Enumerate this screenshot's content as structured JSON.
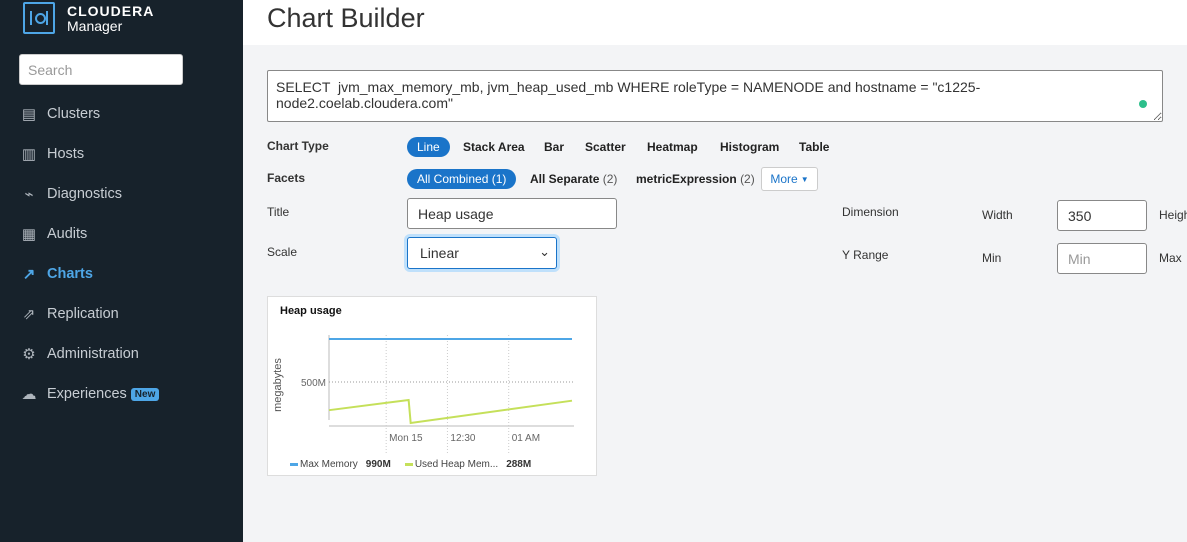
{
  "brand": {
    "name": "CLOUDERA",
    "product": "Manager"
  },
  "sidebar": {
    "search_placeholder": "Search",
    "items": [
      {
        "label": "Clusters",
        "icon": "server-icon"
      },
      {
        "label": "Hosts",
        "icon": "hosts-icon"
      },
      {
        "label": "Diagnostics",
        "icon": "diagnostics-icon"
      },
      {
        "label": "Audits",
        "icon": "audit-icon"
      },
      {
        "label": "Charts",
        "icon": "chart-icon",
        "active": true
      },
      {
        "label": "Replication",
        "icon": "replication-icon"
      },
      {
        "label": "Administration",
        "icon": "gear-icon"
      },
      {
        "label": "Experiences",
        "icon": "cloud-icon",
        "badge": "New"
      }
    ]
  },
  "header": {
    "title": "Chart Builder"
  },
  "query": "SELECT  jvm_max_memory_mb, jvm_heap_used_mb WHERE roleType = NAMENODE and hostname = \"c1225-node2.coelab.cloudera.com\"",
  "form": {
    "chart_type_label": "Chart Type",
    "chart_types": [
      "Line",
      "Stack Area",
      "Bar",
      "Scatter",
      "Heatmap",
      "Histogram",
      "Table"
    ],
    "selected_chart_type": "Line",
    "facets_label": "Facets",
    "facets": [
      {
        "label": "All Combined",
        "count": "(1)"
      },
      {
        "label": "All Separate",
        "count": "(2)"
      },
      {
        "label": "metricExpression",
        "count": "(2)"
      }
    ],
    "more_label": "More",
    "title_label": "Title",
    "title_value": "Heap usage",
    "scale_label": "Scale",
    "scale_value": "Linear",
    "dimension_label": "Dimension",
    "width_label": "Width",
    "width_value": "350",
    "height_label": "Height",
    "yrange_label": "Y Range",
    "min_label": "Min",
    "min_placeholder": "Min",
    "max_label": "Max"
  },
  "colors": {
    "accent": "#1a74c9",
    "max_memory": "#4ea6e6",
    "heap_used": "#c5e05a"
  },
  "chart_data": {
    "type": "line",
    "title": "Heap usage",
    "ylabel": "megabytes",
    "yticks": [
      {
        "value": 500,
        "label": "500M"
      }
    ],
    "ylim": [
      0,
      990
    ],
    "xticks": [
      {
        "value": "00:00",
        "label": "Mon 15"
      },
      {
        "value": "00:30",
        "label": "12:30"
      },
      {
        "value": "01:00",
        "label": "01 AM"
      }
    ],
    "xlim": [
      "23:32",
      "01:31"
    ],
    "grid": true,
    "legend_position": "bottom",
    "series": [
      {
        "name": "Max Memory",
        "summary": "990M",
        "color": "#4ea6e6",
        "points": [
          [
            "23:32",
            990
          ],
          [
            "01:31",
            990
          ]
        ]
      },
      {
        "name": "Used Heap Mem...",
        "summary": "288M",
        "color": "#c5e05a",
        "points": [
          [
            "23:32",
            180
          ],
          [
            "00:11",
            296
          ],
          [
            "00:12",
            34
          ],
          [
            "01:31",
            288
          ]
        ]
      }
    ]
  }
}
